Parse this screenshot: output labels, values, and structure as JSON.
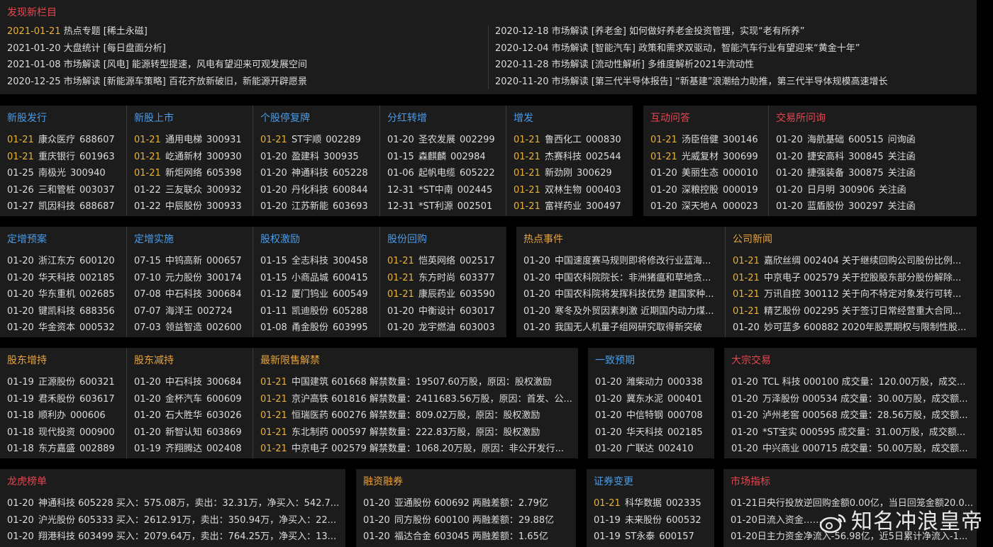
{
  "discover": {
    "title": "发现新栏目",
    "left": [
      {
        "date": "2021-01-21",
        "text": "热点专题 [稀土永磁]",
        "hl": true
      },
      {
        "date": "2021-01-20",
        "text": "大盘统计 [每日盘面分析]",
        "hl": false
      },
      {
        "date": "2021-01-08",
        "text": "市场解读 [风电]  能源转型提速，风电有望迎来可观发展空间",
        "hl": false
      },
      {
        "date": "2020-12-25",
        "text": "市场解读 [新能源车策略]  百花齐放新破旧，新能源开辟愿景",
        "hl": false
      }
    ],
    "right": [
      {
        "date": "2020-12-18",
        "text": "市场解读 [养老金]  如何做好养老金投资管理，实现“老有所养”",
        "hl": false
      },
      {
        "date": "2020-12-04",
        "text": "市场解读 [智能汽车]  政策和需求双驱动，智能汽车行业有望迎来“黄金十年”",
        "hl": false
      },
      {
        "date": "2020-11-28",
        "text": "市场解读 [流动性解析]  多维度解析2021年流动性",
        "hl": false
      },
      {
        "date": "2020-11-20",
        "text": "市场解读 [第三代半导体报告]  “新基建”浪潮给力助推，第三代半导体规模高速增长",
        "hl": false
      }
    ]
  },
  "row1": [
    {
      "title": "新股发行",
      "color": "blue",
      "rows": [
        {
          "date": "01-21",
          "name": "康众医疗",
          "code": "688607",
          "hl": true
        },
        {
          "date": "01-21",
          "name": "重庆银行",
          "code": "601963",
          "hl": true
        },
        {
          "date": "01-25",
          "name": "南极光",
          "code": "300940",
          "hl": false
        },
        {
          "date": "01-26",
          "name": "三和管桩",
          "code": "003037",
          "hl": false
        },
        {
          "date": "01-27",
          "name": "凯因科技",
          "code": "688687",
          "hl": false
        }
      ]
    },
    {
      "title": "新股上市",
      "color": "blue",
      "rows": [
        {
          "date": "01-21",
          "name": "通用电梯",
          "code": "300931",
          "hl": true
        },
        {
          "date": "01-21",
          "name": "屹通新材",
          "code": "300930",
          "hl": true
        },
        {
          "date": "01-21",
          "name": "新炬网络",
          "code": "605398",
          "hl": true
        },
        {
          "date": "01-22",
          "name": "三友联众",
          "code": "300932",
          "hl": false
        },
        {
          "date": "01-22",
          "name": "中辰股份",
          "code": "300933",
          "hl": false
        }
      ]
    },
    {
      "title": "个股停复牌",
      "color": "blue",
      "rows": [
        {
          "date": "01-21",
          "name": "ST宇顺",
          "code": "002289",
          "hl": true
        },
        {
          "date": "01-20",
          "name": "盈建科",
          "code": "300935",
          "hl": false
        },
        {
          "date": "01-20",
          "name": "神通科技",
          "code": "605228",
          "hl": false
        },
        {
          "date": "01-20",
          "name": "丹化科技",
          "code": "600844",
          "hl": false
        },
        {
          "date": "01-20",
          "name": "江苏新能",
          "code": "603693",
          "hl": false
        }
      ]
    },
    {
      "title": "分红转增",
      "color": "blue",
      "rows": [
        {
          "date": "01-20",
          "name": "圣农发展",
          "code": "002299",
          "hl": false
        },
        {
          "date": "01-15",
          "name": "森麒麟",
          "code": "002984",
          "hl": false
        },
        {
          "date": "01-06",
          "name": "起帆电缆",
          "code": "605222",
          "hl": false
        },
        {
          "date": "12-31",
          "name": "*ST中南",
          "code": "002445",
          "hl": false
        },
        {
          "date": "12-31",
          "name": "*ST利源",
          "code": "002501",
          "hl": false
        }
      ]
    },
    {
      "title": "增发",
      "color": "blue",
      "rows": [
        {
          "date": "01-21",
          "name": "鲁西化工",
          "code": "000830",
          "hl": true
        },
        {
          "date": "01-21",
          "name": "杰赛科技",
          "code": "002544",
          "hl": true
        },
        {
          "date": "01-21",
          "name": "新劲刚",
          "code": "300629",
          "hl": true
        },
        {
          "date": "01-21",
          "name": "双林生物",
          "code": "000403",
          "hl": true
        },
        {
          "date": "01-21",
          "name": "富祥药业",
          "code": "300497",
          "hl": true
        }
      ]
    }
  ],
  "row1b": [
    {
      "title": "互动问答",
      "color": "red",
      "rows": [
        {
          "date": "01-21",
          "name": "汤臣倍健",
          "code": "300146",
          "hl": true
        },
        {
          "date": "01-21",
          "name": "光威复材",
          "code": "300699",
          "hl": true
        },
        {
          "date": "01-20",
          "name": "美丽生态",
          "code": "000010",
          "hl": false
        },
        {
          "date": "01-20",
          "name": "深粮控股",
          "code": "000019",
          "hl": false
        },
        {
          "date": "01-20",
          "name": "深天地Ａ",
          "code": "000023",
          "hl": false
        }
      ]
    },
    {
      "title": "交易所问询",
      "color": "red",
      "rows": [
        {
          "date": "01-20",
          "name": "海航基础",
          "code": "600515",
          "extra": "问询函",
          "hl": false
        },
        {
          "date": "01-20",
          "name": "捷安高科",
          "code": "300845",
          "extra": "关注函",
          "hl": false
        },
        {
          "date": "01-20",
          "name": "捷强装备",
          "code": "300875",
          "extra": "关注函",
          "hl": false
        },
        {
          "date": "01-20",
          "name": "日月明",
          "code": "300906",
          "extra": "关注函",
          "hl": false
        },
        {
          "date": "01-20",
          "name": "蓝盾股份",
          "code": "300297",
          "extra": "关注函",
          "hl": false
        }
      ]
    }
  ],
  "row2": [
    {
      "title": "定增预案",
      "color": "blue",
      "rows": [
        {
          "date": "01-20",
          "name": "浙江东方",
          "code": "600120",
          "hl": false
        },
        {
          "date": "01-20",
          "name": "华天科技",
          "code": "002185",
          "hl": false
        },
        {
          "date": "01-20",
          "name": "华东重机",
          "code": "002685",
          "hl": false
        },
        {
          "date": "01-20",
          "name": "键凯科技",
          "code": "688356",
          "hl": false
        },
        {
          "date": "01-20",
          "name": "华金资本",
          "code": "000532",
          "hl": false
        }
      ]
    },
    {
      "title": "定增实施",
      "color": "blue",
      "rows": [
        {
          "date": "07-15",
          "name": "中钨高新",
          "code": "000657",
          "hl": false
        },
        {
          "date": "07-10",
          "name": "元力股份",
          "code": "300174",
          "hl": false
        },
        {
          "date": "07-08",
          "name": "中石科技",
          "code": "300684",
          "hl": false
        },
        {
          "date": "07-07",
          "name": "海洋王",
          "code": "002724",
          "hl": false
        },
        {
          "date": "07-03",
          "name": "领益智造",
          "code": "002600",
          "hl": false
        }
      ]
    },
    {
      "title": "股权激励",
      "color": "blue",
      "rows": [
        {
          "date": "01-15",
          "name": "全志科技",
          "code": "300458",
          "hl": false
        },
        {
          "date": "01-15",
          "name": "小商品城",
          "code": "600415",
          "hl": false
        },
        {
          "date": "01-12",
          "name": "厦门钨业",
          "code": "600549",
          "hl": false
        },
        {
          "date": "01-11",
          "name": "凯迪股份",
          "code": "605288",
          "hl": false
        },
        {
          "date": "01-08",
          "name": "甬金股份",
          "code": "603995",
          "hl": false
        }
      ]
    },
    {
      "title": "股份回购",
      "color": "blue",
      "rows": [
        {
          "date": "01-21",
          "name": "恺英网络",
          "code": "002517",
          "hl": true
        },
        {
          "date": "01-21",
          "name": "东方时尚",
          "code": "603377",
          "hl": true
        },
        {
          "date": "01-21",
          "name": "康辰药业",
          "code": "603590",
          "hl": true
        },
        {
          "date": "01-20",
          "name": "中衡设计",
          "code": "603017",
          "hl": false
        },
        {
          "date": "01-20",
          "name": "龙宇燃油",
          "code": "603003",
          "hl": false
        }
      ]
    }
  ],
  "row2b": [
    {
      "title": "热点事件",
      "color": "orange",
      "rows": [
        {
          "date": "01-20",
          "text": "中国速度赛马规则即将修改行业蓝海...",
          "hl": false
        },
        {
          "date": "01-20",
          "text": "中国农科院院长：非洲猪瘟和草地贪...",
          "hl": false
        },
        {
          "date": "01-20",
          "text": "中国农科院将发挥科技优势 建国家种...",
          "hl": false
        },
        {
          "date": "01-20",
          "text": "寒冬及外贸因素刺激 近期国内动力煤...",
          "hl": false
        },
        {
          "date": "01-20",
          "text": "我国无人机量子组网研究取得新突破",
          "hl": false
        }
      ]
    },
    {
      "title": "公司新闻",
      "color": "orange",
      "rows": [
        {
          "date": "01-21",
          "text": "嘉欣丝绸  002404  关于继续回购公司股份比例...",
          "hl": true
        },
        {
          "date": "01-21",
          "text": "中京电子  002579  关于控股股东部分股份解除...",
          "hl": true
        },
        {
          "date": "01-21",
          "text": "万讯自控  300112  关于向不特定对象发行可转...",
          "hl": true
        },
        {
          "date": "01-21",
          "text": "精艺股份  002295  关于签订日常经营重大合同...",
          "hl": true
        },
        {
          "date": "01-20",
          "text": "妙可蓝多  600882  2020年股票期权与限制性股...",
          "hl": false
        }
      ]
    }
  ],
  "row3": [
    {
      "title": "股东增持",
      "color": "orange",
      "rows": [
        {
          "date": "01-19",
          "name": "正源股份",
          "code": "600321",
          "hl": false
        },
        {
          "date": "01-19",
          "name": "君禾股份",
          "code": "603617",
          "hl": false
        },
        {
          "date": "01-18",
          "name": "顺利办",
          "code": "000606",
          "hl": false
        },
        {
          "date": "01-18",
          "name": "现代投资",
          "code": "000900",
          "hl": false
        },
        {
          "date": "01-18",
          "name": "东方嘉盛",
          "code": "002889",
          "hl": false
        }
      ]
    },
    {
      "title": "股东减持",
      "color": "orange",
      "rows": [
        {
          "date": "01-20",
          "name": "中石科技",
          "code": "300684",
          "hl": false
        },
        {
          "date": "01-20",
          "name": "金杯汽车",
          "code": "600609",
          "hl": false
        },
        {
          "date": "01-20",
          "name": "石大胜华",
          "code": "603026",
          "hl": false
        },
        {
          "date": "01-20",
          "name": "新智认知",
          "code": "603869",
          "hl": false
        },
        {
          "date": "01-19",
          "name": "齐翔腾达",
          "code": "002408",
          "hl": false
        }
      ]
    },
    {
      "title": "最新限售解禁",
      "color": "orange",
      "rows": [
        {
          "date": "01-21",
          "text": "中国建筑  601668  解禁数量：19507.60万股，原因：股权激励",
          "hl": true
        },
        {
          "date": "01-21",
          "text": "京沪高铁  601816  解禁数量：2411683.56万股，原因：首发、公...",
          "hl": true
        },
        {
          "date": "01-21",
          "text": "恒瑞医药  600276  解禁数量：809.02万股，原因：股权激励",
          "hl": true
        },
        {
          "date": "01-21",
          "text": "东北制药  000597  解禁数量：222.83万股，原因：股权激励",
          "hl": true
        },
        {
          "date": "01-21",
          "text": "中京电子  002579  解禁数量：1068.20万股，原因：非公开发行...",
          "hl": true
        }
      ]
    }
  ],
  "row3b": {
    "title": "一致预期",
    "color": "blue",
    "rows": [
      {
        "date": "01-20",
        "name": "潍柴动力",
        "code": "000338",
        "hl": false
      },
      {
        "date": "01-20",
        "name": "冀东水泥",
        "code": "000401",
        "hl": false
      },
      {
        "date": "01-20",
        "name": "中信特钢",
        "code": "000708",
        "hl": false
      },
      {
        "date": "01-20",
        "name": "华天科技",
        "code": "002185",
        "hl": false
      },
      {
        "date": "01-20",
        "name": "广联达",
        "code": "002410",
        "hl": false
      }
    ]
  },
  "row3c": {
    "title": "大宗交易",
    "color": "red",
    "rows": [
      {
        "date": "01-20",
        "text": "TCL 科技  000100  成交量：120.00万股，成交...",
        "hl": false
      },
      {
        "date": "01-20",
        "text": "万泽股份  000534  成交量：30.00万股，成交额...",
        "hl": false
      },
      {
        "date": "01-20",
        "text": "泸州老窖  000568  成交量：28.56万股，成交额...",
        "hl": false
      },
      {
        "date": "01-20",
        "text": "*ST宝实  000595  成交量：31.00万股，成交额...",
        "hl": false
      },
      {
        "date": "01-20",
        "text": "中兴商业  000715  成交量：50.00万股，成交额...",
        "hl": false
      }
    ]
  },
  "row4": {
    "lhb": {
      "title": "龙虎榜单",
      "color": "red",
      "rows": [
        {
          "date": "01-20",
          "text": "神通科技  605228  买入：575.08万，卖出：32.31万，净买入：542.7...",
          "hl": false
        },
        {
          "date": "01-20",
          "text": "沪光股份  605333  买入：2612.91万，卖出：350.94万，净买入：22...",
          "hl": false
        },
        {
          "date": "01-20",
          "text": "翔港科技  603499  买入：2079.64万，卖出：764.25万，净买入：13...",
          "hl": false
        }
      ]
    },
    "rzrq": {
      "title": "融资融券",
      "color": "orange",
      "rows": [
        {
          "date": "01-20",
          "text": "亚通股份  600692  两融差额：2.79亿",
          "hl": false
        },
        {
          "date": "01-20",
          "text": "同方股份  600100  两融差额：29.88亿",
          "hl": false
        },
        {
          "date": "01-20",
          "text": "福达合金  603045  两融差额：1.65亿",
          "hl": false
        }
      ]
    },
    "zqbg": {
      "title": "证券变更",
      "color": "blue",
      "rows": [
        {
          "date": "01-21",
          "name": "科华数据",
          "code": "002335",
          "hl": true
        },
        {
          "date": "01-19",
          "name": "未来股份",
          "code": "600532",
          "hl": false
        },
        {
          "date": "01-19",
          "name": "ST永泰",
          "code": "600157",
          "hl": false
        }
      ]
    },
    "sczb": {
      "title": "市场指标",
      "color": "red",
      "rows": [
        {
          "text": "01-21日央行投放逆回购金额0.00亿，当日回笼金额20.0..."
        },
        {
          "text": "01-20日流入资金……"
        },
        {
          "text": "01-20日主力资金净流入-56.98亿，近5日累计净流入-1..."
        }
      ]
    }
  },
  "watermark": {
    "text": "知名冲浪皇帝",
    "icon": "weibo-icon"
  }
}
